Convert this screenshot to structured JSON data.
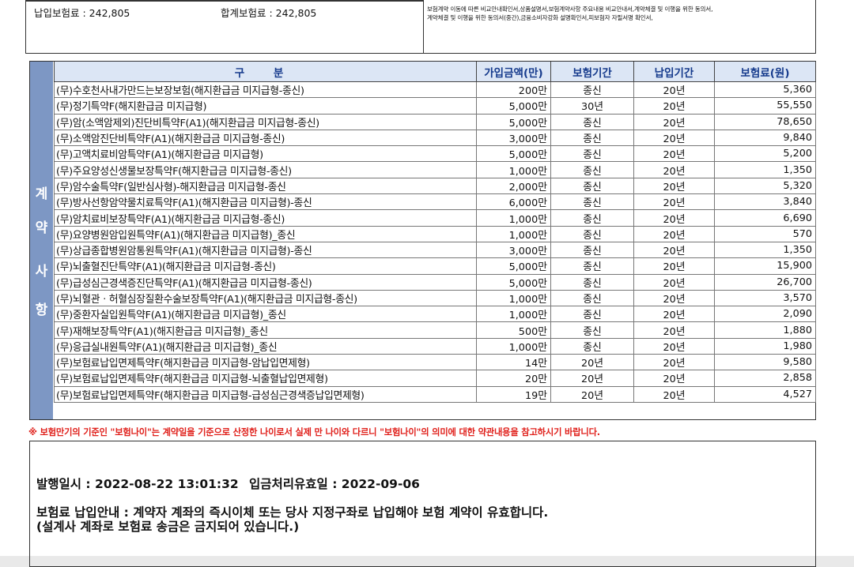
{
  "top": {
    "paid_premium": "납입보험료 : 242,805",
    "total_premium": "합계보험료 : 242,805",
    "docs_line1": "보험계약 이동에 따른 비교안내확인서,상품설명서,보험계약사항 주요내용 비교안내서,계약체결 및 이행을 위한 동의서,",
    "docs_line2": "계약체결 및 이행을 위한 동의서(중간),금융소비자강화 설명확인서,피보험자 자필서명 확인서,"
  },
  "contract": {
    "side_label": [
      "계",
      "약",
      "사",
      "항"
    ],
    "headers": {
      "name": "구 분",
      "amount": "가입금액(만)",
      "period": "보험기간",
      "pay_period": "납입기간",
      "premium": "보험료(원)"
    },
    "rows": [
      {
        "name": "(무)수호천사내가만드는보장보험(해지환급금 미지급형-종신)",
        "amount": "200만",
        "period": "종신",
        "pay": "20년",
        "premium": "5,360"
      },
      {
        "name": "(무)정기특약F(해지환급금 미지급형)",
        "amount": "5,000만",
        "period": "30년",
        "pay": "20년",
        "premium": "55,550"
      },
      {
        "name": "(무)암(소액암제외)진단비특약F(A1)(해지환급금 미지급형-종신)",
        "amount": "5,000만",
        "period": "종신",
        "pay": "20년",
        "premium": "78,650"
      },
      {
        "name": "(무)소액암진단비특약F(A1)(해지환급금 미지급형-종신)",
        "amount": "3,000만",
        "period": "종신",
        "pay": "20년",
        "premium": "9,840"
      },
      {
        "name": "(무)고액치료비암특약F(A1)(해지환급금 미지급형)",
        "amount": "5,000만",
        "period": "종신",
        "pay": "20년",
        "premium": "5,200"
      },
      {
        "name": "(무)주요양성신생물보장특약F(해지환급금 미지급형-종신)",
        "amount": "1,000만",
        "period": "종신",
        "pay": "20년",
        "premium": "1,350"
      },
      {
        "name": "(무)암수술특약F(일반심사형)-해지환급금 미지급형-종신",
        "amount": "2,000만",
        "period": "종신",
        "pay": "20년",
        "premium": "5,320"
      },
      {
        "name": "(무)방사선항암약물치료특약F(A1)(해지환급금 미지급형)-종신",
        "amount": "6,000만",
        "period": "종신",
        "pay": "20년",
        "premium": "3,840"
      },
      {
        "name": "(무)암치료비보장특약F(A1)(해지환급금 미지급형-종신)",
        "amount": "1,000만",
        "period": "종신",
        "pay": "20년",
        "premium": "6,690"
      },
      {
        "name": "(무)요양병원암입원특약F(A1)(해지환급금 미지급형)_종신",
        "amount": "1,000만",
        "period": "종신",
        "pay": "20년",
        "premium": "570"
      },
      {
        "name": "(무)상급종합병원암통원특약F(A1)(해지환급금 미지급형)-종신",
        "amount": "3,000만",
        "period": "종신",
        "pay": "20년",
        "premium": "1,350"
      },
      {
        "name": "(무)뇌출혈진단특약F(A1)(해지환급금 미지급형-종신)",
        "amount": "5,000만",
        "period": "종신",
        "pay": "20년",
        "premium": "15,900"
      },
      {
        "name": "(무)급성심근경색증진단특약F(A1)(해지환급금 미지급형-종신)",
        "amount": "5,000만",
        "period": "종신",
        "pay": "20년",
        "premium": "26,700"
      },
      {
        "name": "(무)뇌혈관ㆍ허혈심장질환수술보장특약F(A1)(해지환급금 미지급형-종신)",
        "amount": "1,000만",
        "period": "종신",
        "pay": "20년",
        "premium": "3,570"
      },
      {
        "name": "(무)중환자실입원특약F(A1)(해지환급금 미지급형)_종신",
        "amount": "1,000만",
        "period": "종신",
        "pay": "20년",
        "premium": "2,090"
      },
      {
        "name": "(무)재해보장특약F(A1)(해지환급금 미지급형)_종신",
        "amount": "500만",
        "period": "종신",
        "pay": "20년",
        "premium": "1,880"
      },
      {
        "name": "(무)응급실내원특약F(A1)(해지환급금 미지급형)_종신",
        "amount": "1,000만",
        "period": "종신",
        "pay": "20년",
        "premium": "1,980"
      },
      {
        "name": "(무)보험료납입면제특약F(해지환급금 미지급형-암납입면제형)",
        "amount": "14만",
        "period": "20년",
        "pay": "20년",
        "premium": "9,580"
      },
      {
        "name": "(무)보험료납입면제특약F(해지환급금 미지급형-뇌출혈납입면제형)",
        "amount": "20만",
        "period": "20년",
        "pay": "20년",
        "premium": "2,858"
      },
      {
        "name": "(무)보험료납입면제특약F(해지환급금 미지급형-급성심근경색증납입면제형)",
        "amount": "19만",
        "period": "20년",
        "pay": "20년",
        "premium": "4,527"
      }
    ]
  },
  "notice": "※ 보험만기의 기준인 \"보험나이\"는 계약일을 기준으로 산정한 나이로서 실제 만 나이와 다르니 \"보험나이\"의 의미에 대한 약관내용을 참고하시기 바랍니다.",
  "issue": {
    "issued": "발행일시 : 2022-08-22 13:01:32",
    "valid_until": "입금처리유효일 : 2022-09-06",
    "payment_line1": "보험료 납입안내 : 계약자 계좌의 즉시이체 또는 당사 지정구좌로 납입해야 보험 계약이 유효합니다.",
    "payment_line2": "(설계사 계좌로 보험료 송금은 금지되어 있습니다.)"
  }
}
